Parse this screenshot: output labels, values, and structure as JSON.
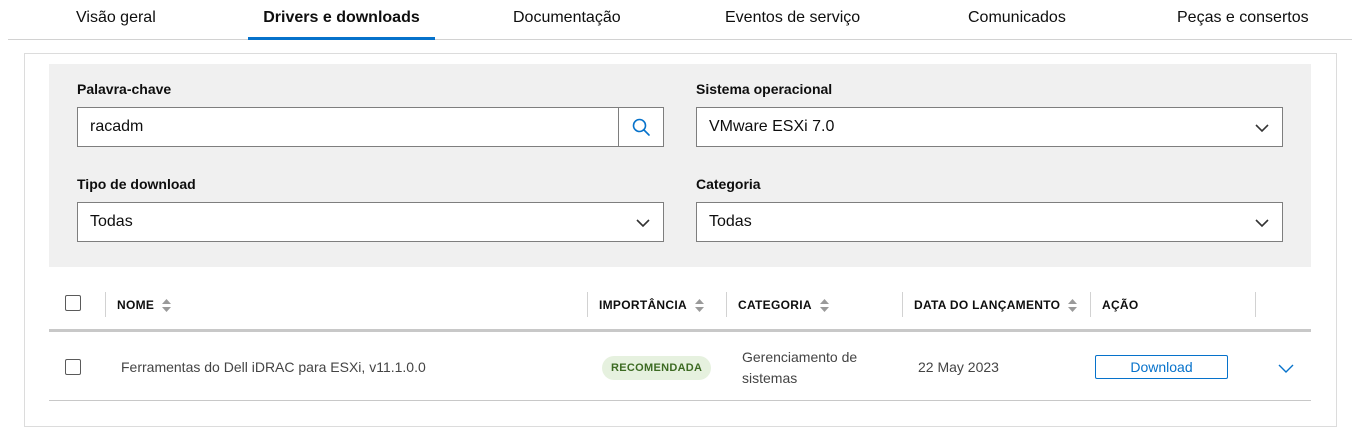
{
  "tabs": [
    {
      "label": "Visão geral"
    },
    {
      "label": "Drivers e downloads",
      "active": true
    },
    {
      "label": "Documentação"
    },
    {
      "label": "Eventos de serviço"
    },
    {
      "label": "Comunicados"
    },
    {
      "label": "Peças e consertos"
    }
  ],
  "filters": {
    "keyword": {
      "label": "Palavra-chave",
      "value": "racadm"
    },
    "os": {
      "label": "Sistema operacional",
      "value": "VMware ESXi 7.0"
    },
    "download_type": {
      "label": "Tipo de download",
      "value": "Todas"
    },
    "category": {
      "label": "Categoria",
      "value": "Todas"
    }
  },
  "table": {
    "headers": {
      "name": "NOME",
      "importance": "IMPORTÂNCIA",
      "category": "CATEGORIA",
      "release_date": "DATA DO LANÇAMENTO",
      "action": "AÇÃO"
    },
    "rows": [
      {
        "name": "Ferramentas do Dell iDRAC para ESXi, v11.1.0.0",
        "importance": "RECOMENDADA",
        "category_line1": "Gerenciamento de",
        "category_line2": "sistemas",
        "release_date": "22 May 2023",
        "action_label": "Download"
      }
    ]
  },
  "colors": {
    "accent": "#0672cb",
    "badge_bg": "#e6f1df",
    "badge_text": "#3d6b23",
    "filter_bg": "#f0f0f0"
  },
  "icons": [
    "search-icon",
    "chevron-down-icon",
    "sort-icon",
    "expand-chevron-icon"
  ]
}
